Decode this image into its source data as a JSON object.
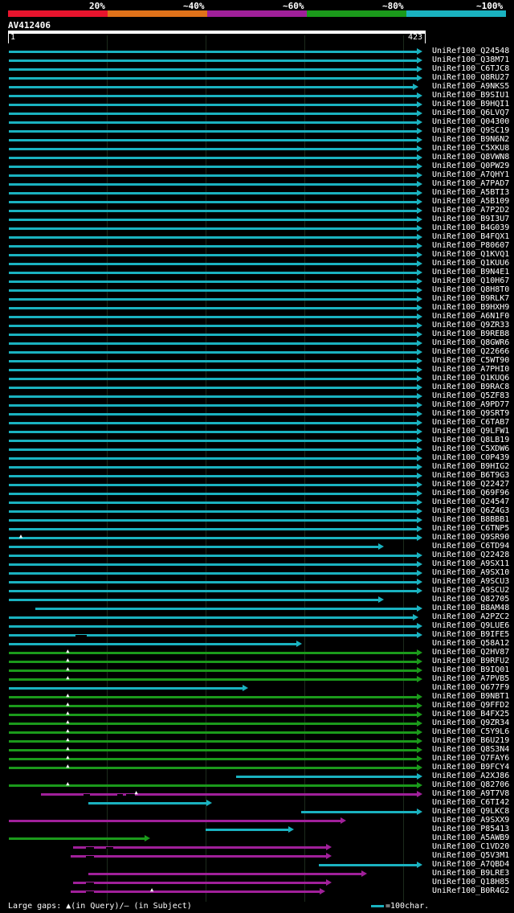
{
  "colors": {
    "red": "#e8142d",
    "orange": "#e0721a",
    "purple": "#a0209a",
    "green": "#1b9a1b",
    "cyan": "#1ab2c0"
  },
  "legend": [
    {
      "label": "20%",
      "color": "#e8142d"
    },
    {
      "label": "~40%",
      "color": "#e0721a"
    },
    {
      "label": "~60%",
      "color": "#a0209a"
    },
    {
      "label": "~80%",
      "color": "#1b9a1b"
    },
    {
      "label": "~100%",
      "color": "#1ab2c0"
    }
  ],
  "query": {
    "name": "AV412406",
    "start": "1",
    "end": "423",
    "length": 423
  },
  "footer": {
    "gaps_text": "Large gaps: ▲(in Query)/— (in Subject)",
    "scale_text": "=100char."
  },
  "hits": [
    {
      "name": "UniRef100_Q24548",
      "s": 1,
      "e": 423,
      "c": "cyan"
    },
    {
      "name": "UniRef100_Q38M71",
      "s": 1,
      "e": 423,
      "c": "cyan"
    },
    {
      "name": "UniRef100_C6TJC8",
      "s": 1,
      "e": 423,
      "c": "cyan"
    },
    {
      "name": "UniRef100_Q8RU27",
      "s": 1,
      "e": 423,
      "c": "cyan"
    },
    {
      "name": "UniRef100_A9NKS5",
      "s": 1,
      "e": 419,
      "c": "cyan"
    },
    {
      "name": "UniRef100_B9SIU1",
      "s": 1,
      "e": 423,
      "c": "cyan"
    },
    {
      "name": "UniRef100_B9HQI1",
      "s": 1,
      "e": 423,
      "c": "cyan"
    },
    {
      "name": "UniRef100_Q6LVQ7",
      "s": 1,
      "e": 423,
      "c": "cyan"
    },
    {
      "name": "UniRef100_Q04300",
      "s": 1,
      "e": 423,
      "c": "cyan"
    },
    {
      "name": "UniRef100_Q9SC19",
      "s": 1,
      "e": 423,
      "c": "cyan"
    },
    {
      "name": "UniRef100_B9N6N2",
      "s": 1,
      "e": 423,
      "c": "cyan"
    },
    {
      "name": "UniRef100_C5XKU8",
      "s": 1,
      "e": 423,
      "c": "cyan"
    },
    {
      "name": "UniRef100_Q8VWN8",
      "s": 1,
      "e": 423,
      "c": "cyan"
    },
    {
      "name": "UniRef100_Q0PW29",
      "s": 1,
      "e": 423,
      "c": "cyan"
    },
    {
      "name": "UniRef100_A7QHY1",
      "s": 1,
      "e": 423,
      "c": "cyan"
    },
    {
      "name": "UniRef100_A7PAD7",
      "s": 1,
      "e": 423,
      "c": "cyan"
    },
    {
      "name": "UniRef100_A5BTI3",
      "s": 1,
      "e": 423,
      "c": "cyan"
    },
    {
      "name": "UniRef100_A5B109",
      "s": 1,
      "e": 423,
      "c": "cyan"
    },
    {
      "name": "UniRef100_A7P2D2",
      "s": 1,
      "e": 423,
      "c": "cyan"
    },
    {
      "name": "UniRef100_B9I3U7",
      "s": 1,
      "e": 423,
      "c": "cyan"
    },
    {
      "name": "UniRef100_B4G039",
      "s": 1,
      "e": 423,
      "c": "cyan"
    },
    {
      "name": "UniRef100_B4FQX1",
      "s": 1,
      "e": 423,
      "c": "cyan"
    },
    {
      "name": "UniRef100_P80607",
      "s": 1,
      "e": 423,
      "c": "cyan"
    },
    {
      "name": "UniRef100_Q1KVQ1",
      "s": 1,
      "e": 423,
      "c": "cyan"
    },
    {
      "name": "UniRef100_Q1KUU6",
      "s": 1,
      "e": 423,
      "c": "cyan"
    },
    {
      "name": "UniRef100_B9N4E1",
      "s": 1,
      "e": 423,
      "c": "cyan"
    },
    {
      "name": "UniRef100_Q10H67",
      "s": 1,
      "e": 423,
      "c": "cyan"
    },
    {
      "name": "UniRef100_Q8H8T0",
      "s": 1,
      "e": 423,
      "c": "cyan"
    },
    {
      "name": "UniRef100_B9RLK7",
      "s": 1,
      "e": 423,
      "c": "cyan"
    },
    {
      "name": "UniRef100_B9HXH9",
      "s": 1,
      "e": 423,
      "c": "cyan"
    },
    {
      "name": "UniRef100_A6N1F0",
      "s": 1,
      "e": 423,
      "c": "cyan"
    },
    {
      "name": "UniRef100_Q9ZR33",
      "s": 1,
      "e": 423,
      "c": "cyan"
    },
    {
      "name": "UniRef100_B9REB8",
      "s": 1,
      "e": 423,
      "c": "cyan"
    },
    {
      "name": "UniRef100_Q8GWR6",
      "s": 1,
      "e": 423,
      "c": "cyan"
    },
    {
      "name": "UniRef100_Q22666",
      "s": 1,
      "e": 423,
      "c": "cyan"
    },
    {
      "name": "UniRef100_C5WT90",
      "s": 1,
      "e": 423,
      "c": "cyan"
    },
    {
      "name": "UniRef100_A7PHI0",
      "s": 1,
      "e": 423,
      "c": "cyan"
    },
    {
      "name": "UniRef100_Q1KUQ6",
      "s": 1,
      "e": 423,
      "c": "cyan"
    },
    {
      "name": "UniRef100_B9RAC8",
      "s": 1,
      "e": 423,
      "c": "cyan"
    },
    {
      "name": "UniRef100_Q5ZF83",
      "s": 1,
      "e": 423,
      "c": "cyan"
    },
    {
      "name": "UniRef100_A9PD77",
      "s": 1,
      "e": 423,
      "c": "cyan"
    },
    {
      "name": "UniRef100_Q9SRT9",
      "s": 1,
      "e": 423,
      "c": "cyan"
    },
    {
      "name": "UniRef100_C6TAB7",
      "s": 1,
      "e": 423,
      "c": "cyan"
    },
    {
      "name": "UniRef100_Q9LFW1",
      "s": 1,
      "e": 423,
      "c": "cyan"
    },
    {
      "name": "UniRef100_Q8LB19",
      "s": 1,
      "e": 423,
      "c": "cyan"
    },
    {
      "name": "UniRef100_C5XDW6",
      "s": 1,
      "e": 423,
      "c": "cyan"
    },
    {
      "name": "UniRef100_C0P439",
      "s": 1,
      "e": 423,
      "c": "cyan"
    },
    {
      "name": "UniRef100_B9HIG2",
      "s": 1,
      "e": 423,
      "c": "cyan"
    },
    {
      "name": "UniRef100_B6T9G3",
      "s": 1,
      "e": 423,
      "c": "cyan"
    },
    {
      "name": "UniRef100_Q22427",
      "s": 1,
      "e": 423,
      "c": "cyan"
    },
    {
      "name": "UniRef100_Q69F96",
      "s": 1,
      "e": 423,
      "c": "cyan"
    },
    {
      "name": "UniRef100_Q24547",
      "s": 1,
      "e": 423,
      "c": "cyan"
    },
    {
      "name": "UniRef100_Q6Z4G3",
      "s": 1,
      "e": 423,
      "c": "cyan"
    },
    {
      "name": "UniRef100_B8BBB1",
      "s": 1,
      "e": 423,
      "c": "cyan"
    },
    {
      "name": "UniRef100_C6TNP5",
      "s": 1,
      "e": 423,
      "c": "cyan"
    },
    {
      "name": "UniRef100_Q9SR90",
      "s": 1,
      "e": 423,
      "c": "cyan",
      "qgaps": [
        14
      ]
    },
    {
      "name": "UniRef100_C6TD94",
      "s": 1,
      "e": 384,
      "c": "cyan"
    },
    {
      "name": "UniRef100_Q22428",
      "s": 1,
      "e": 423,
      "c": "cyan"
    },
    {
      "name": "UniRef100_A9SX11",
      "s": 1,
      "e": 423,
      "c": "cyan"
    },
    {
      "name": "UniRef100_A9SX10",
      "s": 1,
      "e": 423,
      "c": "cyan"
    },
    {
      "name": "UniRef100_A9SCU3",
      "s": 1,
      "e": 423,
      "c": "cyan"
    },
    {
      "name": "UniRef100_A9SCU2",
      "s": 1,
      "e": 423,
      "c": "cyan"
    },
    {
      "name": "UniRef100_Q82705",
      "s": 1,
      "e": 384,
      "c": "cyan"
    },
    {
      "name": "UniRef100_B8AM48",
      "s": 28,
      "e": 423,
      "c": "cyan"
    },
    {
      "name": "UniRef100_A2PZC2",
      "s": 1,
      "e": 419,
      "c": "cyan"
    },
    {
      "name": "UniRef100_Q9LUE6",
      "s": 1,
      "e": 423,
      "c": "cyan"
    },
    {
      "name": "UniRef100_B9IFE5",
      "s": 1,
      "e": 423,
      "c": "cyan",
      "sgaps": [
        [
          69,
          81
        ]
      ]
    },
    {
      "name": "UniRef100_Q58A12",
      "s": 1,
      "e": 300,
      "c": "cyan"
    },
    {
      "name": "UniRef100_Q2HV87",
      "s": 1,
      "e": 423,
      "c": "green",
      "qgaps": [
        62
      ]
    },
    {
      "name": "UniRef100_B9RFU2",
      "s": 1,
      "e": 423,
      "c": "green",
      "qgaps": [
        62
      ]
    },
    {
      "name": "UniRef100_B9IQ01",
      "s": 1,
      "e": 423,
      "c": "green",
      "qgaps": [
        62
      ]
    },
    {
      "name": "UniRef100_A7PVB5",
      "s": 1,
      "e": 423,
      "c": "green",
      "qgaps": [
        62
      ]
    },
    {
      "name": "UniRef100_Q677F9",
      "s": 1,
      "e": 245,
      "c": "cyan"
    },
    {
      "name": "UniRef100_B9NBT1",
      "s": 1,
      "e": 423,
      "c": "green",
      "qgaps": [
        62
      ]
    },
    {
      "name": "UniRef100_Q9FFD2",
      "s": 1,
      "e": 423,
      "c": "green",
      "qgaps": [
        62
      ]
    },
    {
      "name": "UniRef100_B4FX25",
      "s": 1,
      "e": 423,
      "c": "green",
      "qgaps": [
        62
      ]
    },
    {
      "name": "UniRef100_Q9ZR34",
      "s": 1,
      "e": 423,
      "c": "green",
      "qgaps": [
        62
      ]
    },
    {
      "name": "UniRef100_C5Y9L6",
      "s": 1,
      "e": 423,
      "c": "green",
      "qgaps": [
        62
      ]
    },
    {
      "name": "UniRef100_B6U219",
      "s": 1,
      "e": 423,
      "c": "green",
      "qgaps": [
        62
      ]
    },
    {
      "name": "UniRef100_Q8S3N4",
      "s": 1,
      "e": 423,
      "c": "green",
      "qgaps": [
        62
      ]
    },
    {
      "name": "UniRef100_Q7FAY6",
      "s": 1,
      "e": 423,
      "c": "green",
      "qgaps": [
        62
      ]
    },
    {
      "name": "UniRef100_B9FCY4",
      "s": 1,
      "e": 423,
      "c": "green",
      "qgaps": [
        62
      ]
    },
    {
      "name": "UniRef100_A2XJ86",
      "s": 233,
      "e": 423,
      "c": "cyan"
    },
    {
      "name": "UniRef100_Q82706",
      "s": 1,
      "e": 423,
      "c": "green",
      "qgaps": [
        62
      ]
    },
    {
      "name": "UniRef100_A9T7V8",
      "s": 34,
      "e": 423,
      "c": "purple",
      "qgaps": [
        132
      ],
      "sgaps": [
        [
          77,
          84
        ],
        [
          112,
          118
        ],
        [
          121,
          130
        ]
      ]
    },
    {
      "name": "UniRef100_C6TI42",
      "s": 82,
      "e": 208,
      "c": "cyan"
    },
    {
      "name": "UniRef100_Q9LKC8",
      "s": 300,
      "e": 423,
      "c": "cyan"
    },
    {
      "name": "UniRef100_A9SXX9",
      "s": 1,
      "e": 345,
      "c": "purple"
    },
    {
      "name": "UniRef100_P85413",
      "s": 202,
      "e": 292,
      "c": "cyan"
    },
    {
      "name": "UniRef100_A5AWB9",
      "s": 1,
      "e": 145,
      "c": "green"
    },
    {
      "name": "UniRef100_C1VD20",
      "s": 67,
      "e": 330,
      "c": "purple",
      "sgaps": [
        [
          80,
          88
        ],
        [
          100,
          108
        ]
      ]
    },
    {
      "name": "UniRef100_Q5V3M1",
      "s": 64,
      "e": 330,
      "c": "purple",
      "sgaps": [
        [
          80,
          88
        ]
      ]
    },
    {
      "name": "UniRef100_A7QBD4",
      "s": 318,
      "e": 423,
      "c": "cyan"
    },
    {
      "name": "UniRef100_B9LRE3",
      "s": 82,
      "e": 366,
      "c": "purple"
    },
    {
      "name": "UniRef100_Q18H85",
      "s": 67,
      "e": 330,
      "c": "purple",
      "sgaps": [
        [
          80,
          88
        ]
      ]
    },
    {
      "name": "UniRef100_B0R4G2",
      "s": 64,
      "e": 324,
      "c": "purple",
      "qgaps": [
        148
      ],
      "sgaps": [
        [
          80,
          88
        ]
      ]
    }
  ]
}
